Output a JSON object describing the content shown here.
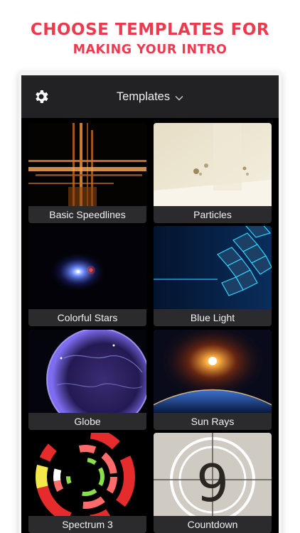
{
  "headline": {
    "line1": "CHOOSE TEMPLATES FOR",
    "line2": "MAKING YOUR INTRO"
  },
  "colors": {
    "accent": "#ee3a4f",
    "navbar": "#222224",
    "caption_bg": "#2b2b2d"
  },
  "navbar": {
    "title": "Templates",
    "left_icon": "gear-icon",
    "title_icon": "chevron-down-icon"
  },
  "templates": [
    {
      "label": "Basic Speedlines"
    },
    {
      "label": "Particles"
    },
    {
      "label": "Colorful Stars"
    },
    {
      "label": "Blue Light"
    },
    {
      "label": "Globe"
    },
    {
      "label": "Sun Rays"
    },
    {
      "label": "Spectrum 3"
    },
    {
      "label": "Countdown"
    }
  ],
  "countdown_digit": "9"
}
